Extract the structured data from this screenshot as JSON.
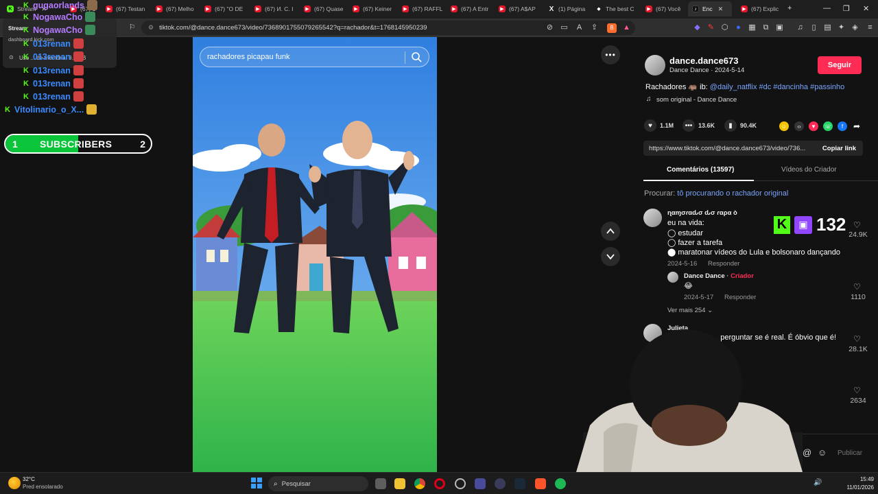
{
  "browser": {
    "tabs": [
      {
        "label": "Stream",
        "icon": "kick-icon"
      },
      {
        "label": "(67) 1 O",
        "icon": "youtube-icon"
      },
      {
        "label": "(67) Testan",
        "icon": "youtube-icon"
      },
      {
        "label": "(67) Melho",
        "icon": "youtube-icon"
      },
      {
        "label": "(67) \"O DE",
        "icon": "youtube-icon"
      },
      {
        "label": "(67) И. С. I",
        "icon": "youtube-icon"
      },
      {
        "label": "(67) Quase",
        "icon": "youtube-icon"
      },
      {
        "label": "(67) Keiner",
        "icon": "youtube-icon"
      },
      {
        "label": "(67) RAFFL",
        "icon": "youtube-icon"
      },
      {
        "label": "(67) A Entr",
        "icon": "youtube-icon"
      },
      {
        "label": "(67) A$AP",
        "icon": "youtube-icon"
      },
      {
        "label": "(1) Página",
        "icon": "x-icon"
      },
      {
        "label": "The best C",
        "icon": "gem-icon"
      },
      {
        "label": "(67) Você",
        "icon": "youtube-icon"
      },
      {
        "label": "Enc",
        "icon": "tiktok-icon"
      },
      {
        "label": "(67) Explic",
        "icon": "youtube-icon"
      }
    ],
    "url": "tiktok.com/@dance.dance673/video/7368901755079265542?q=rachador&t=1768145950239"
  },
  "overlay": {
    "extension_popup": {
      "title": "Stream",
      "subtitle": "dashboard.kick.com",
      "memory": "Uso ... de memória: 9... MB"
    },
    "chat": [
      {
        "name": "gugaorlands",
        "color": "#b57bff"
      },
      {
        "name": "NogawaCho",
        "color": "#b57bff"
      },
      {
        "name": "NogawaCho",
        "color": "#b57bff"
      },
      {
        "name": "013renan",
        "color": "#3b8bff"
      },
      {
        "name": "013renan",
        "color": "#3b8bff"
      },
      {
        "name": "013renan",
        "color": "#3b8bff"
      },
      {
        "name": "013renan",
        "color": "#3b8bff"
      },
      {
        "name": "013renan",
        "color": "#3b8bff"
      },
      {
        "name": "Vitolinario_o_X...",
        "color": "#3b8bff"
      }
    ],
    "subscribers": {
      "current": "1",
      "label": "SUBSCRIBERS",
      "goal": "2",
      "progress": 0.5
    },
    "viewer_count": "132"
  },
  "video": {
    "search_query": "rachadores picapau funk"
  },
  "panel": {
    "author_handle": "dance.dance673",
    "author_meta": "Dance Dance · 2024-5-14",
    "follow_label": "Seguir",
    "caption_prefix": "Rachadores 🦛 ib: ",
    "caption_links": "@daily_natflix #dc #dancinha #passinho",
    "sound": "som original - Dance Dance",
    "likes": "1.1M",
    "comments": "13.6K",
    "saves": "90.4K",
    "share_url": "https://www.tiktok.com/@dance.dance673/video/736...",
    "copy_label": "Copiar link",
    "tab_comments": "Comentários (13597)",
    "tab_creator_videos": "Vídeos do Criador",
    "search_prefix": "Procurar: ",
    "search_suggestion": "tô procurando o rachador original",
    "comments_list": [
      {
        "user": "ɳαɱσɾαԃσ ԃσ ɾαρα ò",
        "lines": [
          "eu na vida:",
          "◯ estudar",
          "◯ fazer a tarefa",
          "⬤ maratonar vídeos do Lula e bolsonaro dançando"
        ],
        "date": "2024-5-16",
        "reply_label": "Responder",
        "likes": "24.9K"
      },
      {
        "user": "Dance Dance",
        "creator_badge": "Criador",
        "text": "😂",
        "date": "2024-5-17",
        "reply_label": "Responder",
        "likes": "1110"
      },
      {
        "user": "Julieta",
        "text": "... perguntar se é real. É óbvio que é!",
        "likes": "28.1K"
      },
      {
        "likes": "2634"
      }
    ],
    "more_replies": "Ver mais 254",
    "post_label": "Publicar"
  },
  "taskbar": {
    "weather_temp": "32°C",
    "weather_desc": "Pred ensolarado",
    "search_placeholder": "Pesquisar",
    "time": "15:49",
    "date": "11/01/2026"
  },
  "colors": {
    "kick_green": "#53fc18",
    "follow_red": "#fe2c55",
    "link_blue": "#7aa5ff",
    "creator_red": "#fe2c55",
    "sub_green": "#0ac43a"
  }
}
